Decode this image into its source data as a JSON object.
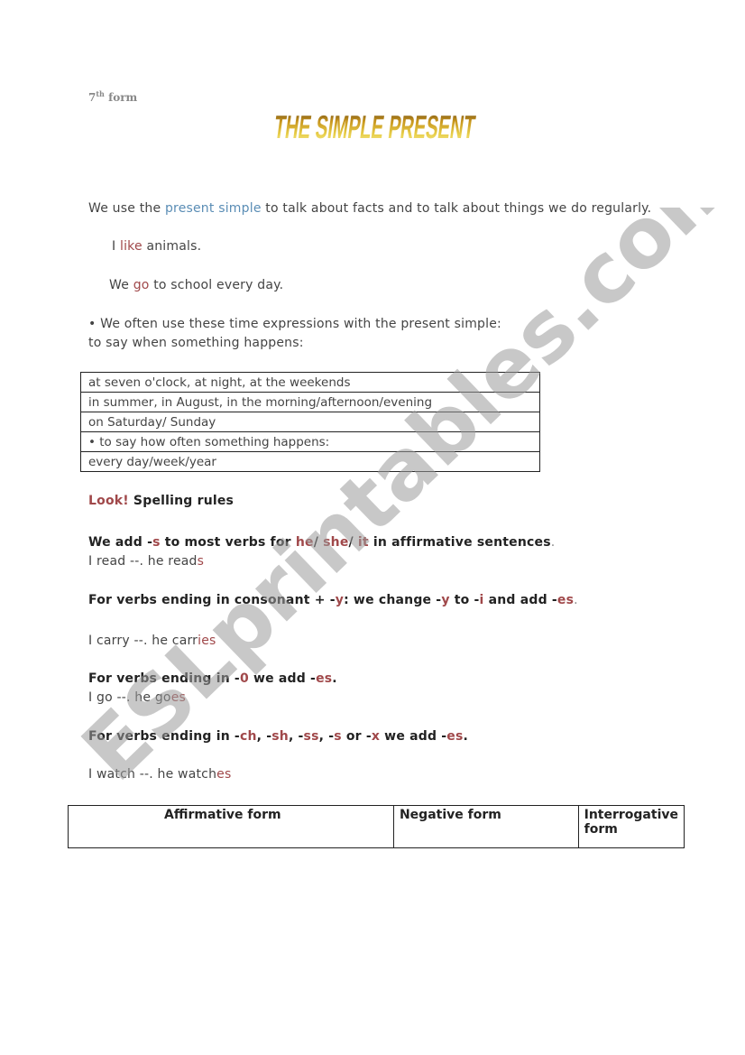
{
  "header": {
    "form_number": "7",
    "form_sup": "th",
    "form_word": "form",
    "title": "THE SIMPLE PRESENT"
  },
  "intro": {
    "part1": "We use the ",
    "highlight": "present simple",
    "part2": " to talk about facts and to talk about things we do regularly."
  },
  "examples": [
    {
      "pre": "I ",
      "verb": "like",
      "post": " animals."
    },
    {
      "pre": "We ",
      "verb": "go",
      "post": " to school every day."
    }
  ],
  "time_expressions": {
    "line1": "• We often use these time expressions with the present simple:",
    "line2": "to say when something happens:",
    "rows": [
      "at seven o'clock, at night, at the weekends",
      "in summer, in August, in the morning/afternoon/evening",
      "on Saturday/ Sunday",
      "• to say how often something happens:",
      "every day/week/year"
    ]
  },
  "spelling": {
    "look": "Look!",
    "heading": " Spelling rules",
    "rule1": {
      "a": "We add -",
      "s": "s",
      "b": " to most verbs for ",
      "he": "he",
      "sl1": "/ ",
      "she": "she",
      "sl2": "/ ",
      "it": "it",
      "c": " in affirmative sentences",
      "d": "."
    },
    "ex1": {
      "a": "I read --. he read",
      "b": "s"
    },
    "rule2": {
      "a": "For verbs ending in consonant + -",
      "y1": "y",
      "b": ": we change -",
      "y2": "y",
      "c": " to -",
      "i": "i",
      "d": " and add -",
      "es": "es",
      "e": "."
    },
    "ex2": {
      "a": "I carry --. he carr",
      "b": "ies"
    },
    "rule3": {
      "a": "For verbs ending in -",
      "o": "0",
      "b": " we add -",
      "es": "es",
      "c": "."
    },
    "ex3": {
      "a": "I go --. he go",
      "b": "es"
    },
    "rule4": {
      "a": "For verbs ending in -",
      "ch": "ch",
      "b": ", -",
      "sh": "sh",
      "c": ", -",
      "ss": "ss",
      "d": ", -",
      "s": "s",
      "e": " or -",
      "x": "x",
      "f": " we add -",
      "es": "es",
      "g": "."
    },
    "ex4": {
      "a": "I watch --. he watch",
      "b": "es"
    }
  },
  "forms_table": {
    "headers": [
      "Affirmative form",
      "Negative form",
      "Interrogative form"
    ]
  },
  "watermark": "ESLprintables.com"
}
